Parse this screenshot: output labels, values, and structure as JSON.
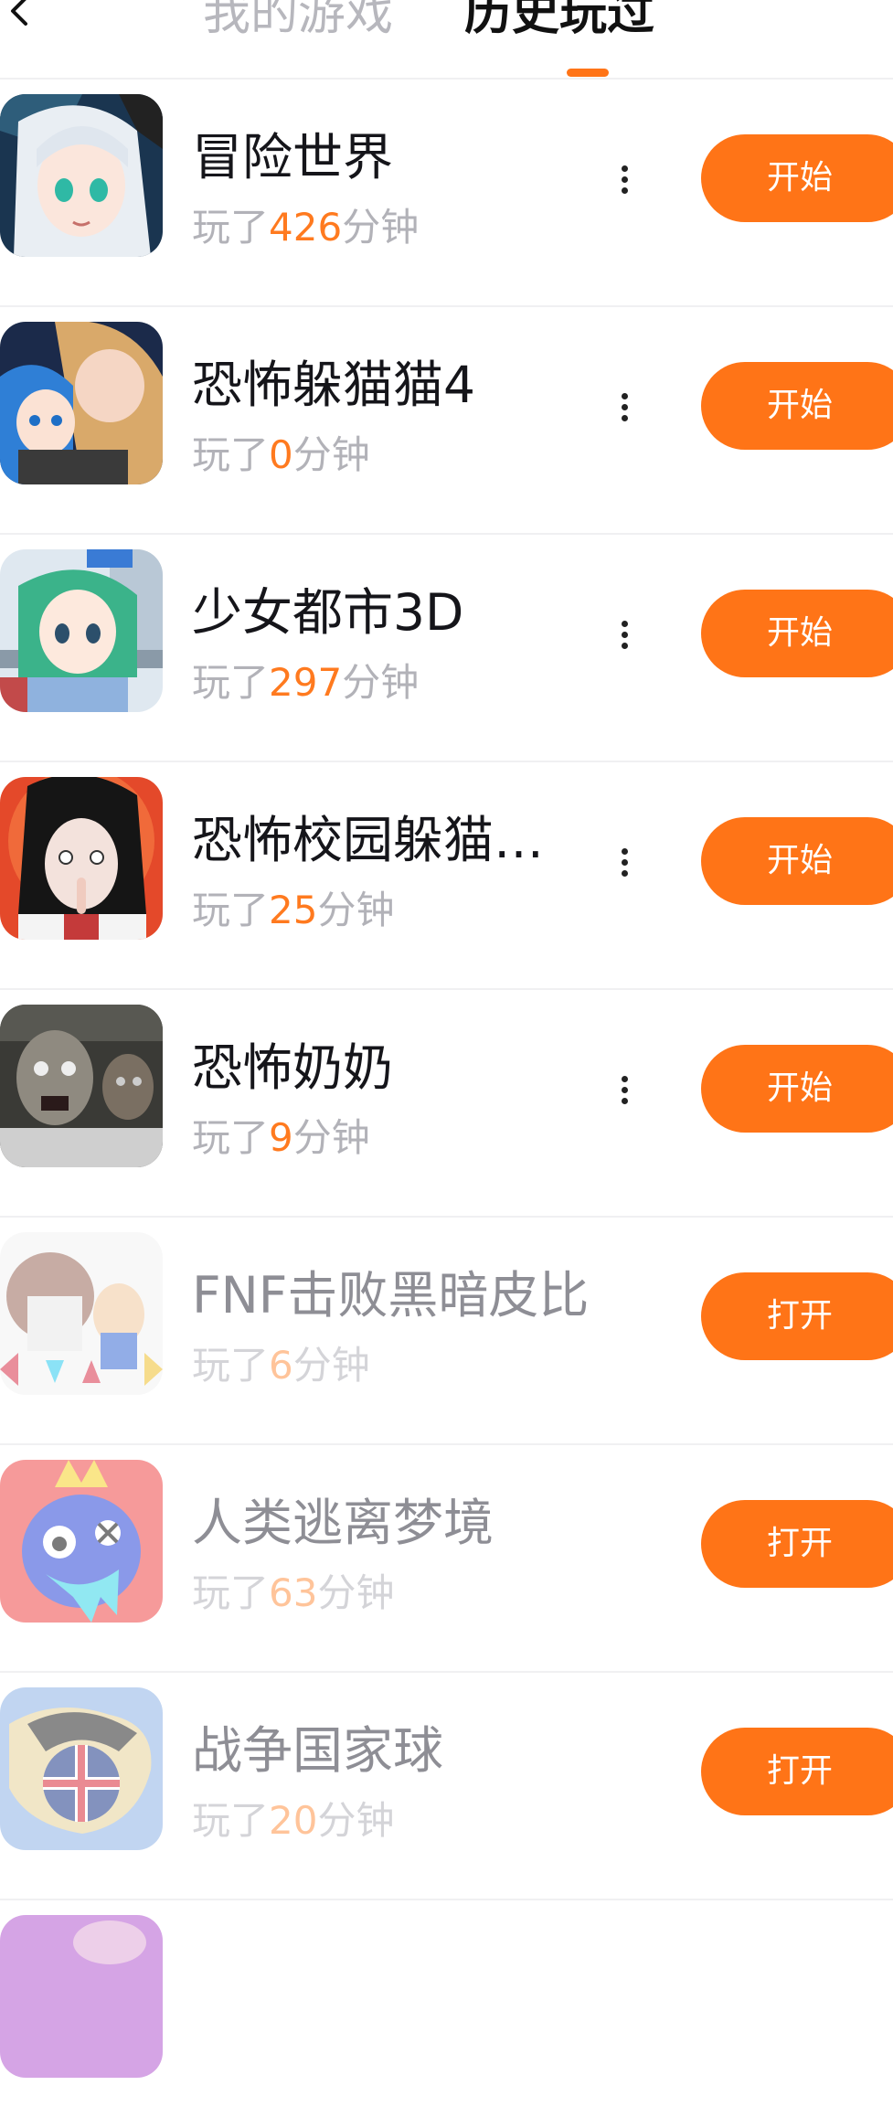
{
  "header": {
    "tabs": [
      {
        "label": "我的游戏"
      },
      {
        "label": "历史玩过"
      }
    ]
  },
  "theme": {
    "accent": "#ff7417",
    "title_color": "#15151a",
    "muted": "#b2b2b8"
  },
  "games": [
    {
      "title": "冒险世界",
      "played_prefix": "玩了",
      "minutes": "426",
      "played_suffix": "分钟",
      "button": "开始",
      "has_more": true,
      "icon": "anime-girl-icon"
    },
    {
      "title": "恐怖躲猫猫4",
      "played_prefix": "玩了",
      "minutes": "0",
      "played_suffix": "分钟",
      "button": "开始",
      "has_more": true,
      "icon": "anime-duo-icon"
    },
    {
      "title": "少女都市3D",
      "played_prefix": "玩了",
      "minutes": "297",
      "played_suffix": "分钟",
      "button": "开始",
      "has_more": true,
      "icon": "schoolgirl-icon"
    },
    {
      "title": "恐怖校园躲猫…",
      "played_prefix": "玩了",
      "minutes": "25",
      "played_suffix": "分钟",
      "button": "开始",
      "has_more": true,
      "icon": "horror-girl-icon"
    },
    {
      "title": "恐怖奶奶",
      "played_prefix": "玩了",
      "minutes": "9",
      "played_suffix": "分钟",
      "button": "开始",
      "has_more": true,
      "icon": "granny-icon"
    },
    {
      "title": "FNF击败黑暗皮比",
      "played_prefix": "玩了",
      "minutes": "6",
      "played_suffix": "分钟",
      "button": "打开",
      "has_more": false,
      "icon": "fnf-arrows-icon"
    },
    {
      "title": "人类逃离梦境",
      "played_prefix": "玩了",
      "minutes": "63",
      "played_suffix": "分钟",
      "button": "打开",
      "has_more": false,
      "icon": "blue-monster-icon"
    },
    {
      "title": "战争国家球",
      "played_prefix": "玩了",
      "minutes": "20",
      "played_suffix": "分钟",
      "button": "打开",
      "has_more": false,
      "icon": "countryball-icon"
    }
  ]
}
